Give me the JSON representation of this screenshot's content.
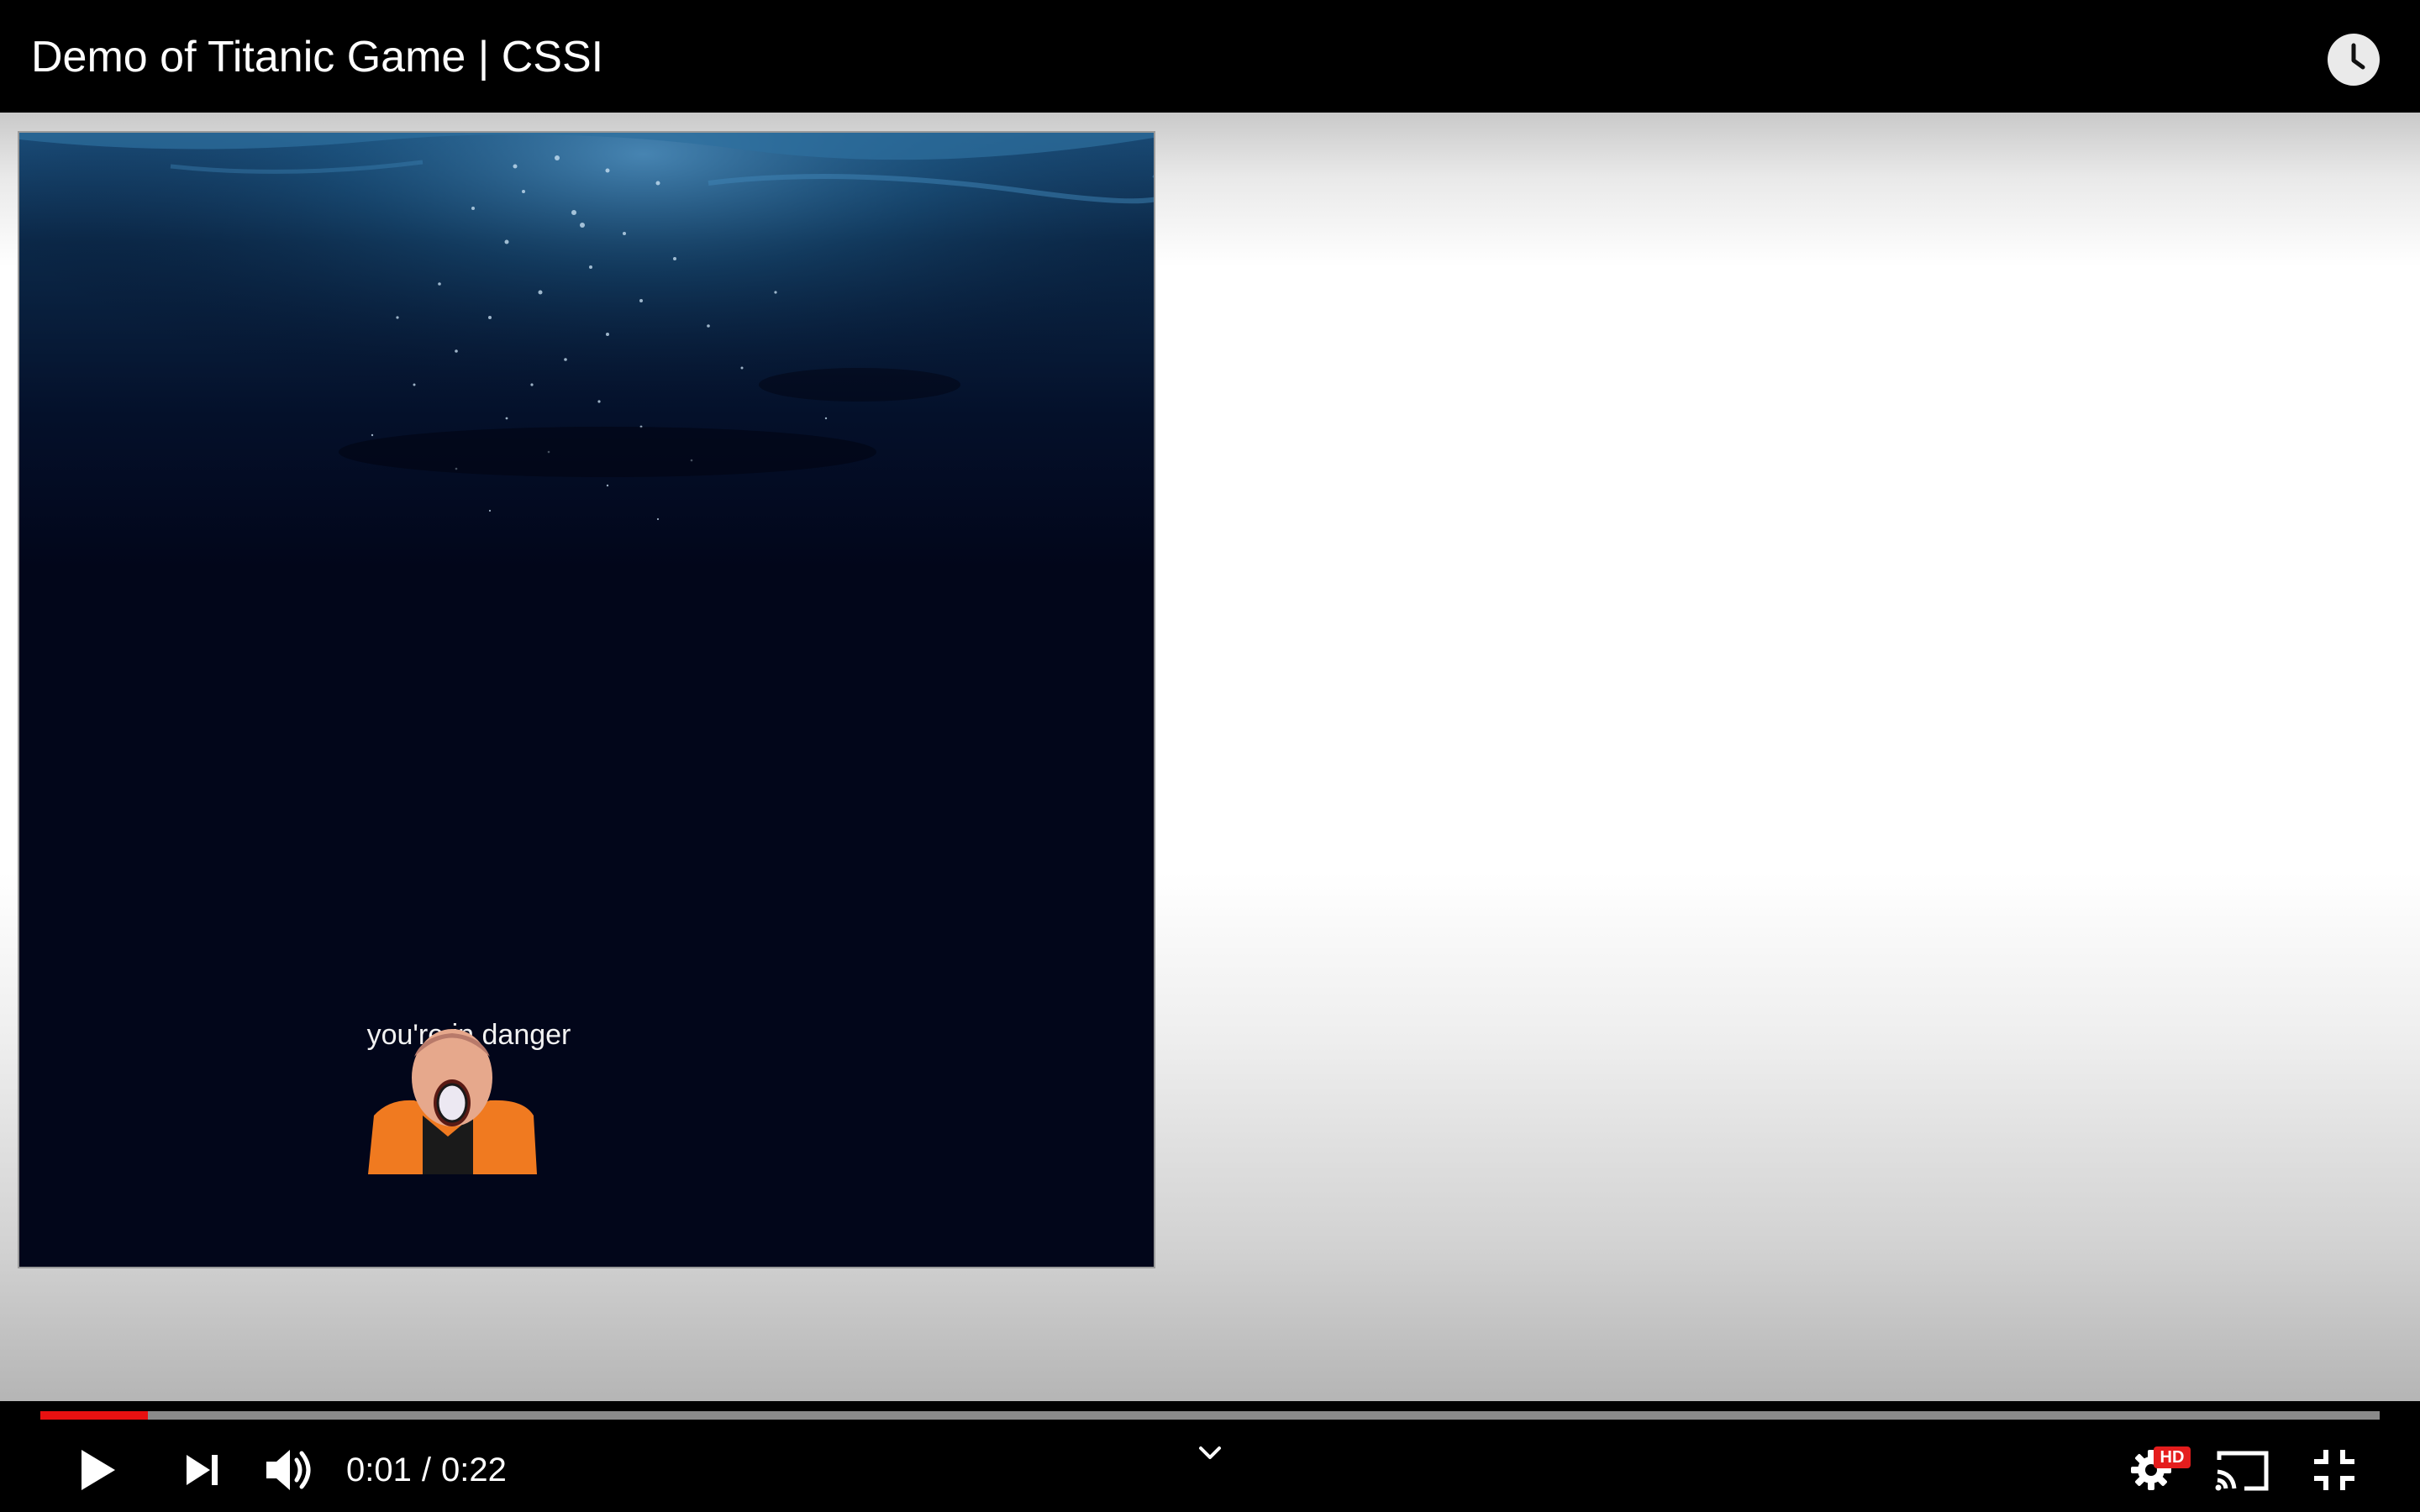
{
  "header": {
    "title": "Demo of Titanic Game | CSSI",
    "watch_later_icon": "clock-icon"
  },
  "video": {
    "game_text": "you're in danger"
  },
  "player": {
    "progress_fraction": 0.046,
    "current_time": "0:01",
    "separator": "/",
    "duration": "0:22",
    "hd_badge": "HD",
    "colors": {
      "progress": "#e81111",
      "background": "#000000"
    },
    "icons": [
      "play-icon",
      "next-icon",
      "volume-icon",
      "chevron-down-icon",
      "settings-icon",
      "cast-icon",
      "exit-fullscreen-icon"
    ]
  }
}
